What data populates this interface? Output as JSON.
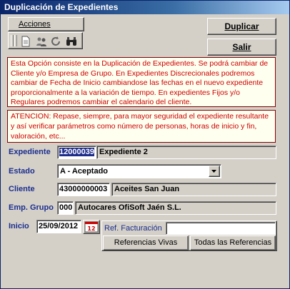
{
  "window": {
    "title": "Duplicación de Expedientes"
  },
  "tabs": {
    "acciones": "Acciones"
  },
  "toolbar": {
    "icons": [
      "document-icon",
      "people-icon",
      "refresh-icon",
      "binoculars-icon"
    ]
  },
  "buttons": {
    "duplicar": "Duplicar",
    "salir": "Salir"
  },
  "info_text": "Esta Opción consiste en la Duplicación de Expedientes. Se podrá cambiar de Cliente y/o Empresa de Grupo. En Expedientes Discrecionales podremos cambiar de Fecha de Inicio cambiandose  las fechas en el nuevo expediente proporcionalmente a la variación de tiempo. En expedientes Fijos y/o Regulares podremos cambiar el calendario del cliente.",
  "warning_text": "ATENCION: Repase, siempre, para mayor seguridad el expediente resultante y así verificar parámetros como número de personas, horas de inicio y fin, valoración,   etc...",
  "form": {
    "expediente": {
      "label": "Expediente",
      "code": "12000039",
      "name": "Expediente 2"
    },
    "estado": {
      "label": "Estado",
      "value": "A - Aceptado"
    },
    "cliente": {
      "label": "Cliente",
      "code": "43000000003",
      "name": "Aceites San Juan"
    },
    "emp_grupo": {
      "label": "Emp. Grupo",
      "code": "000",
      "name": "Autocares OfiSoft Jaén S.L."
    },
    "inicio": {
      "label": "Inicio",
      "date": "25/09/2012"
    },
    "ref_facturacion": {
      "label": "Ref. Facturación",
      "value": ""
    },
    "referencias_vivas": "Referencias Vivas",
    "todas_referencias": "Todas las Referencias"
  },
  "colors": {
    "title_bar": "#0a246a",
    "label": "#1c2f8e",
    "info_text": "#cc0000",
    "info_bg": "#fffff0"
  }
}
